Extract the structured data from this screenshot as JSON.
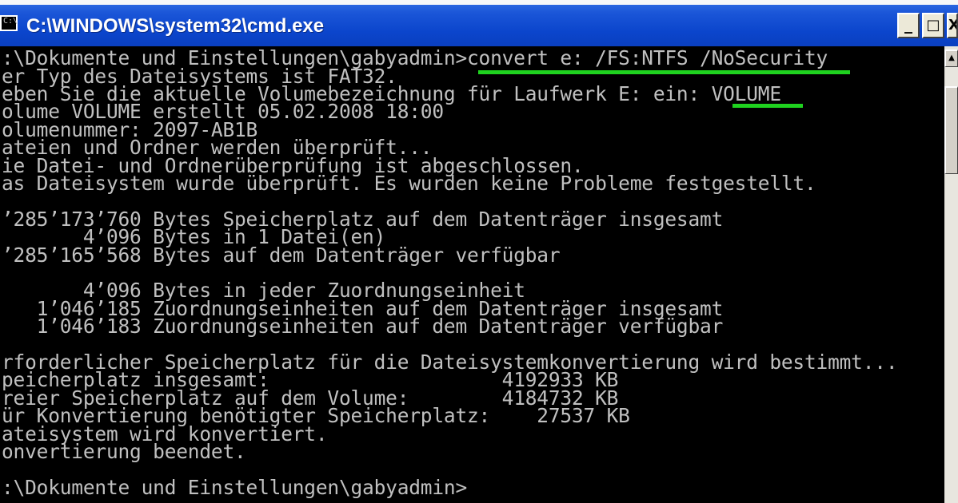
{
  "window": {
    "title": "C:\\WINDOWS\\system32\\cmd.exe",
    "icon": "console-icon",
    "buttons": {
      "minimize": "_",
      "maximize": "□",
      "close": "X"
    }
  },
  "console": {
    "lines": [
      ":\\Dokumente und Einstellungen\\gabyadmin>convert e: /FS:NTFS /NoSecurity",
      "er Typ des Dateisystems ist FAT32.",
      "eben Sie die aktuelle Volumebezeichnung für Laufwerk E: ein: VOLUME",
      "olume VOLUME erstellt 05.02.2008 18:00",
      "olumenummer: 2097-AB1B",
      "ateien und Ordner werden überprüft...",
      "ie Datei- und Ordnerüberprüfung ist abgeschlossen.",
      "as Dateisystem wurde überprüft. Es wurden keine Probleme festgestellt.",
      "",
      "’285’173’760 Bytes Speicherplatz auf dem Datenträger insgesamt",
      "       4’096 Bytes in 1 Datei(en)",
      "’285’165’568 Bytes auf dem Datenträger verfügbar",
      "",
      "       4’096 Bytes in jeder Zuordnungseinheit",
      "   1’046’185 Zuordnungseinheiten auf dem Datenträger insgesamt",
      "   1’046’183 Zuordnungseinheiten auf dem Datenträger verfügbar",
      "",
      "rforderlicher Speicherplatz für die Dateisystemkonvertierung wird bestimmt...",
      "peicherplatz insgesamt:                    4192933 KB",
      "reier Speicherplatz auf dem Volume:        4184732 KB",
      "ür Konvertierung benötigter Speicherplatz:    27537 KB",
      "ateisystem wird konvertiert.",
      "onvertierung beendet.",
      "",
      ":\\Dokumente und Einstellungen\\gabyadmin>"
    ],
    "highlight_color": "#1fd21f"
  }
}
